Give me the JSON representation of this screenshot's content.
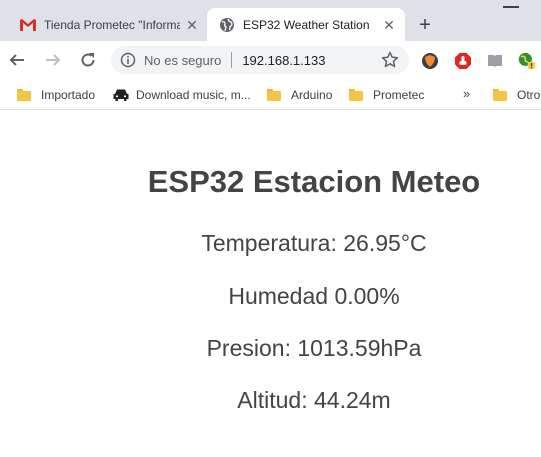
{
  "browser": {
    "tabs": [
      {
        "title": "Tienda Prometec \"Informa",
        "favicon": "gmail-icon",
        "active": false
      },
      {
        "title": "ESP32 Weather Station",
        "favicon": "globe-icon",
        "active": true
      }
    ],
    "new_tab_label": "+",
    "close_label": "✕"
  },
  "toolbar": {
    "security_label": "No es seguro",
    "url": "192.168.1.133"
  },
  "bookmarks": [
    {
      "label": "Importado",
      "icon": "folder-icon"
    },
    {
      "label": "Download music, m...",
      "icon": "car-icon"
    },
    {
      "label": "Arduino",
      "icon": "folder-icon"
    },
    {
      "label": "Prometec",
      "icon": "folder-icon"
    },
    {
      "label": "Otro",
      "icon": "folder-icon"
    }
  ],
  "bookmarks_overflow": "»",
  "page": {
    "heading": "ESP32 Estacion Meteo",
    "temperature": "Temperatura: 26.95°C",
    "humidity": "Humedad 0.00%",
    "pressure": "Presion: 1013.59hPa",
    "altitude": "Altitud: 44.24m"
  }
}
